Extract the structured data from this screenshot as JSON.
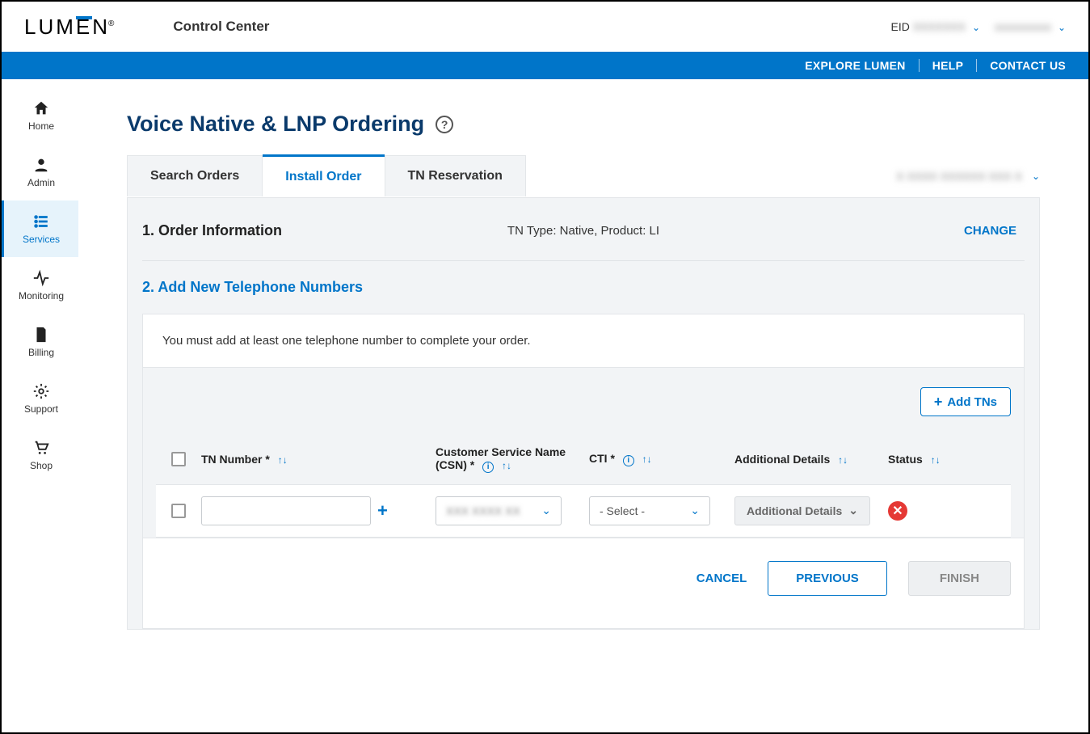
{
  "header": {
    "logo_text": "LUM",
    "logo_text2": "N",
    "e_char": "E",
    "reg": "®",
    "control_center": "Control Center",
    "eid_label": "EID",
    "eid_value": "XXXXXXX",
    "user_value": "xxxxxxxxxx"
  },
  "bluebar": {
    "explore": "EXPLORE LUMEN",
    "help": "HELP",
    "contact": "CONTACT US"
  },
  "sidebar": {
    "items": [
      {
        "label": "Home"
      },
      {
        "label": "Admin"
      },
      {
        "label": "Services"
      },
      {
        "label": "Monitoring"
      },
      {
        "label": "Billing"
      },
      {
        "label": "Support"
      },
      {
        "label": "Shop"
      }
    ]
  },
  "page": {
    "title": "Voice Native & LNP Ordering",
    "help_glyph": "?"
  },
  "tabs": {
    "search": "Search Orders",
    "install": "Install Order",
    "tnres": "TN Reservation",
    "location": "X XXXX XXXXXX XXX X"
  },
  "step1": {
    "title": "1. Order Information",
    "summary": "TN Type: Native, Product: LI",
    "change": "CHANGE"
  },
  "step2": {
    "title": "2. Add New Telephone Numbers",
    "info": "You must add at least one telephone number to complete your order.",
    "add_tns": "Add TNs"
  },
  "table": {
    "headers": {
      "tn": "TN Number *",
      "csn": "Customer Service Name (CSN) *",
      "cti": "CTI *",
      "additional": "Additional Details",
      "status": "Status"
    },
    "row": {
      "csn_value": "XXX XXXX XX",
      "cti_value": "- Select -",
      "additional_label": "Additional Details"
    }
  },
  "actions": {
    "cancel": "CANCEL",
    "previous": "PREVIOUS",
    "finish": "FINISH"
  }
}
